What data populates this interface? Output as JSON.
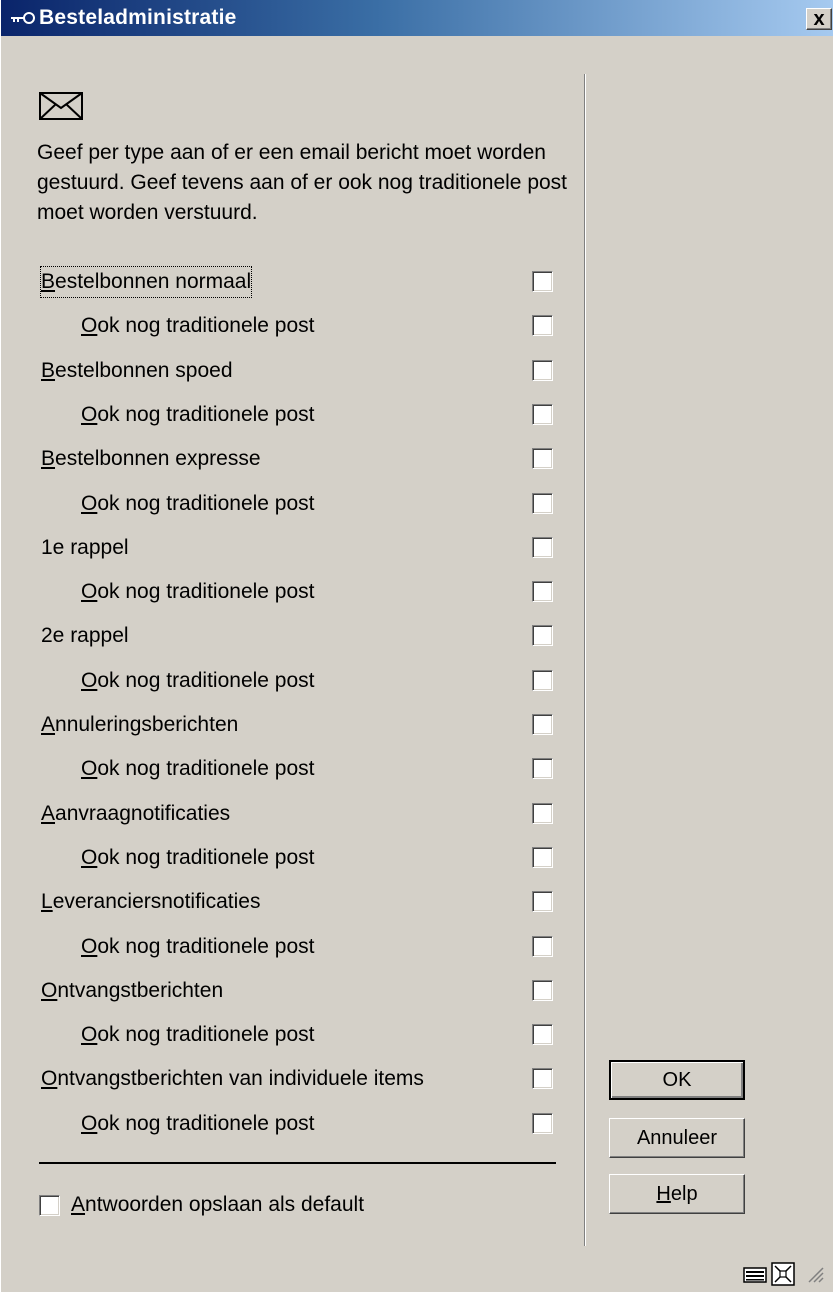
{
  "window": {
    "title": "Besteladministratie",
    "close_label": "x"
  },
  "intro_text": "Geef per type aan of er een email bericht moet worden gestuurd. Geef tevens aan of er ook nog traditionele post moet worden verstuurd.",
  "options": [
    {
      "label": "Bestelbonnen normaal",
      "accel": "B",
      "rest": "estelbonnen normaal",
      "checked": false
    },
    {
      "label": "Ook nog traditionele post",
      "accel": "O",
      "rest": "ok nog traditionele post",
      "checked": false
    },
    {
      "label": "Bestelbonnen spoed",
      "accel": "B",
      "rest": "estelbonnen spoed",
      "checked": false
    },
    {
      "label": "Ook nog traditionele post",
      "accel": "O",
      "rest": "ok nog traditionele post",
      "checked": false
    },
    {
      "label": "Bestelbonnen expresse",
      "accel": "B",
      "rest": "estelbonnen expresse",
      "checked": false
    },
    {
      "label": "Ook nog traditionele post",
      "accel": "O",
      "rest": "ok nog traditionele post",
      "checked": false
    },
    {
      "label": "1e rappel",
      "accel": "",
      "rest": "1e rappel",
      "checked": false
    },
    {
      "label": "Ook nog traditionele post",
      "accel": "O",
      "rest": "ok nog traditionele post",
      "checked": false
    },
    {
      "label": "2e rappel",
      "accel": "",
      "rest": "2e rappel",
      "checked": false
    },
    {
      "label": "Ook nog traditionele post",
      "accel": "O",
      "rest": "ok nog traditionele post",
      "checked": false
    },
    {
      "label": "Annuleringsberichten",
      "accel": "A",
      "rest": "nnuleringsberichten",
      "checked": false
    },
    {
      "label": "Ook nog traditionele post",
      "accel": "O",
      "rest": "ok nog traditionele post",
      "checked": false
    },
    {
      "label": "Aanvraagnotificaties",
      "accel": "A",
      "rest": "anvraagnotificaties",
      "checked": false
    },
    {
      "label": "Ook nog traditionele post",
      "accel": "O",
      "rest": "ok nog traditionele post",
      "checked": false
    },
    {
      "label": "Leveranciersnotificaties",
      "accel": "L",
      "rest": "everanciersnotificaties",
      "checked": false
    },
    {
      "label": "Ook nog traditionele post",
      "accel": "O",
      "rest": "ok nog traditionele post",
      "checked": false
    },
    {
      "label": "Ontvangstberichten",
      "accel": "O",
      "rest": "ntvangstberichten",
      "checked": false
    },
    {
      "label": "Ook nog traditionele post",
      "accel": "O",
      "rest": "ok nog traditionele post",
      "checked": false
    },
    {
      "label": "Ontvangstberichten van individuele items",
      "accel": "O",
      "rest": "ntvangstberichten van individuele items",
      "checked": false
    },
    {
      "label": "Ook nog traditionele post",
      "accel": "O",
      "rest": "ok nog traditionele post",
      "checked": false
    }
  ],
  "save_default": {
    "accel": "A",
    "rest": "ntwoorden opslaan als default",
    "checked": false
  },
  "buttons": {
    "ok": "OK",
    "cancel": "Annuleer",
    "help_accel": "H",
    "help_rest": "elp"
  },
  "icons": {
    "title": "key-icon",
    "envelope": "envelope-icon",
    "status_1": "keyboard-icon",
    "status_2": "resize-icon",
    "status_3": "size-grip-icon"
  }
}
